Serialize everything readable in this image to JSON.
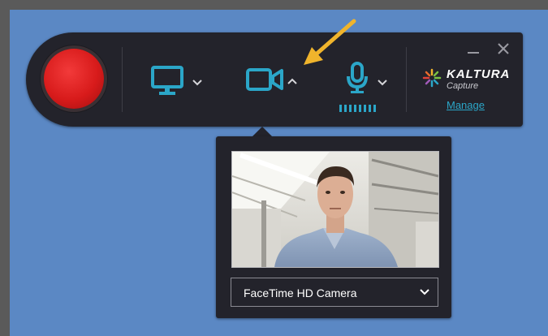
{
  "app": {
    "brand_name": "KALTURA",
    "brand_sub": "Capture",
    "manage_link": "Manage"
  },
  "toolbar": {
    "record": {
      "icon": "record-circle-icon",
      "color": "#d81b1b"
    },
    "screen": {
      "icon": "monitor-icon",
      "dropdown": "chevron-down-icon"
    },
    "camera": {
      "icon": "video-camera-icon",
      "dropdown": "chevron-up-icon",
      "expanded": true
    },
    "microphone": {
      "icon": "microphone-icon",
      "dropdown": "chevron-down-icon",
      "level_bars": 8
    },
    "window_controls": {
      "minimize": "minimize-icon",
      "close": "close-icon"
    }
  },
  "camera_panel": {
    "preview": "webcam-preview",
    "selected_device": "FaceTime HD Camera"
  },
  "colors": {
    "accent": "#2ba6c8",
    "toolbar_bg": "#23232b",
    "desktop_bg": "#5b88c4",
    "annotation_arrow": "#f0b42c"
  }
}
